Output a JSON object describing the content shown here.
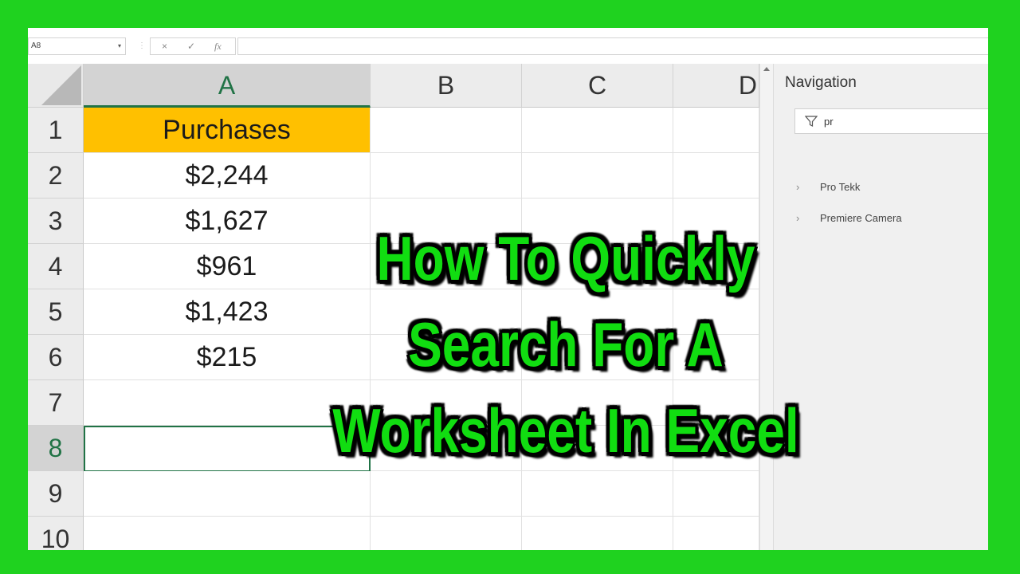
{
  "formula_bar": {
    "name_box": "A8",
    "cancel_icon": "×",
    "enter_icon": "✓",
    "function_icon": "fx",
    "formula_value": ""
  },
  "columns": [
    "A",
    "B",
    "C",
    "D"
  ],
  "rows": [
    "1",
    "2",
    "3",
    "4",
    "5",
    "6",
    "7",
    "8",
    "9",
    "10"
  ],
  "cells": {
    "A1": "Purchases",
    "A2": "$2,244",
    "A3": "$1,627",
    "A4": "$961",
    "A5": "$1,423",
    "A6": "$215"
  },
  "active_cell": "A8",
  "colors": {
    "header_fill": "#ffc000",
    "selection": "#217346",
    "border_green": "#1fd21f",
    "overlay_text": "#11dd11"
  },
  "navigation": {
    "title": "Navigation",
    "search_value": "pr",
    "items": [
      {
        "label": "Pro Tekk"
      },
      {
        "label": "Premiere Camera"
      }
    ]
  },
  "overlay_title": {
    "line1": "How To Quickly",
    "line2": "Search For A",
    "line3": "Worksheet In Excel"
  }
}
